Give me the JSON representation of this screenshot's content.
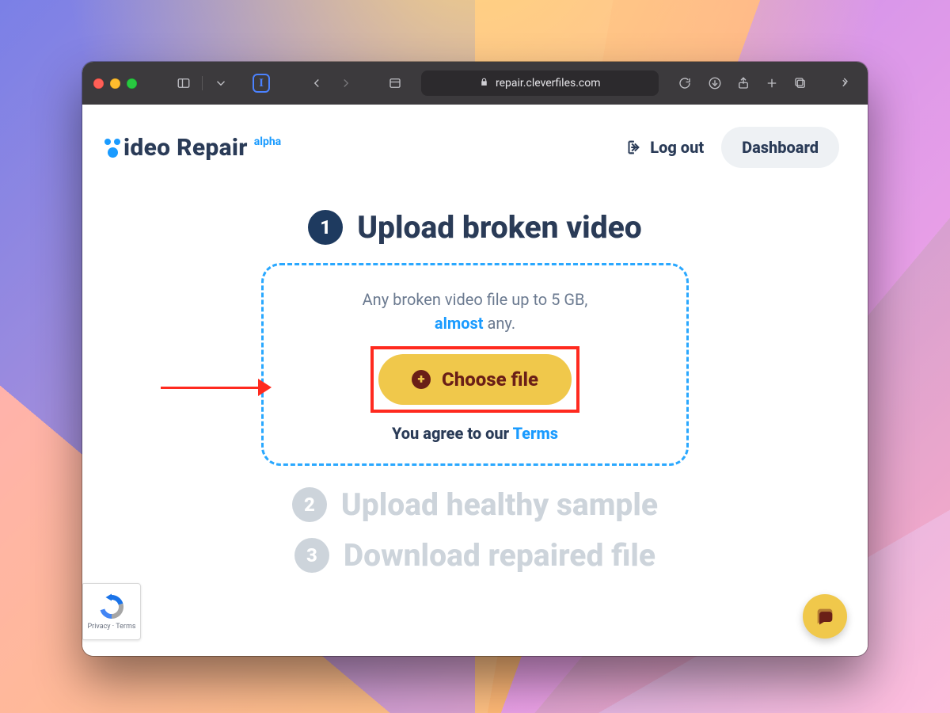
{
  "browser": {
    "url_host": "repair.cleverfiles.com"
  },
  "brand": {
    "name_v": "V",
    "name_rest": "ideo Repair",
    "tag": "alpha"
  },
  "nav": {
    "logout": "Log out",
    "dashboard": "Dashboard"
  },
  "steps": {
    "s1": {
      "num": "1",
      "title": "Upload broken video"
    },
    "s2": {
      "num": "2",
      "title": "Upload healthy sample"
    },
    "s3": {
      "num": "3",
      "title": "Download repaired file"
    }
  },
  "dropzone": {
    "line1": "Any broken video file up to 5 GB,",
    "almost": "almost",
    "line2_rest": " any.",
    "choose": "Choose file",
    "terms_prefix": "You agree to our ",
    "terms_link": "Terms"
  },
  "recaptcha": {
    "label": "Privacy  ·  Terms"
  }
}
